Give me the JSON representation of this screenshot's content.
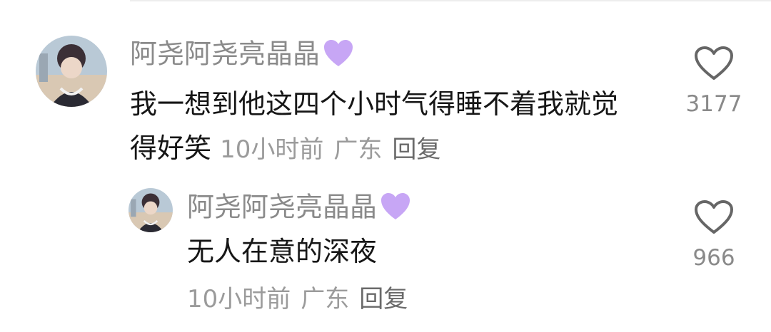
{
  "comment": {
    "username": "阿尧阿尧亮晶晶",
    "text": "我一想到他这四个小时气得睡不着我就觉得好笑",
    "time": "10小时前",
    "location": "广东",
    "reply_label": "回复",
    "likes": "3177"
  },
  "reply": {
    "username": "阿尧阿尧亮晶晶",
    "text": "无人在意的深夜",
    "time": "10小时前",
    "location": "广东",
    "reply_label": "回复",
    "likes": "966"
  },
  "colors": {
    "heart_emoji": "#c7a6f5",
    "like_outline": "#666666",
    "username": "#8a8a8a",
    "meta": "#9b9b9b"
  },
  "icons": {
    "name_badge": "purple-heart-icon",
    "like": "heart-outline-icon"
  }
}
